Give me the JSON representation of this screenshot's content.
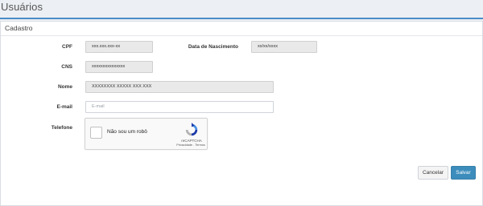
{
  "page": {
    "title": "Usuários"
  },
  "panel": {
    "title": "Cadastro"
  },
  "form": {
    "cpf_label": "CPF",
    "cpf_value": "xxx.xxx.xxx-xx",
    "birth_label": "Data de Nascimento",
    "birth_value": "xx/xx/xxxx",
    "cns_label": "CNS",
    "cns_value": "xxxxxxxxxxxxxxx",
    "name_label": "Nome",
    "name_value": "XXXXXXXX XXXXX XXX XXX",
    "email_label": "E-mail",
    "email_placeholder": "E-mail",
    "phone_label": "Telefone",
    "phone_value": ""
  },
  "recaptcha": {
    "label": "Não sou um robô",
    "brand": "reCAPTCHA",
    "links": "Privacidade - Termos",
    "icon": "recaptcha-logo-icon"
  },
  "actions": {
    "cancel_label": "Cancelar",
    "save_label": "Salvar"
  },
  "colors": {
    "accent": "#4a8cc7",
    "save_button": "#3c8dbc",
    "readonly_field": "#e9e9e9",
    "background": "#eceff3"
  }
}
